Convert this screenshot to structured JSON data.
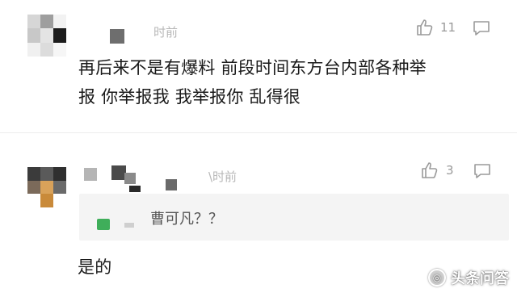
{
  "comments": [
    {
      "time": "时前",
      "likes": "11",
      "text_line1": "再后来不是有爆料 前段时间东方台内部各种举",
      "text_line2": "报 你举报我 我举报你 乱得很"
    },
    {
      "time": "\\时前",
      "likes": "3",
      "quote": "曹可凡？？",
      "text": "是的"
    }
  ],
  "watermark": {
    "text": "头条问答"
  },
  "icons": {
    "like": "thumbs-up-icon",
    "reply": "speech-bubble-icon"
  },
  "colors": {
    "text": "#1a1a1a",
    "muted": "#b8b8b8",
    "icon": "#9a9a9a",
    "quote_bg": "#f4f4f4",
    "accent_green": "#3fae5a"
  }
}
